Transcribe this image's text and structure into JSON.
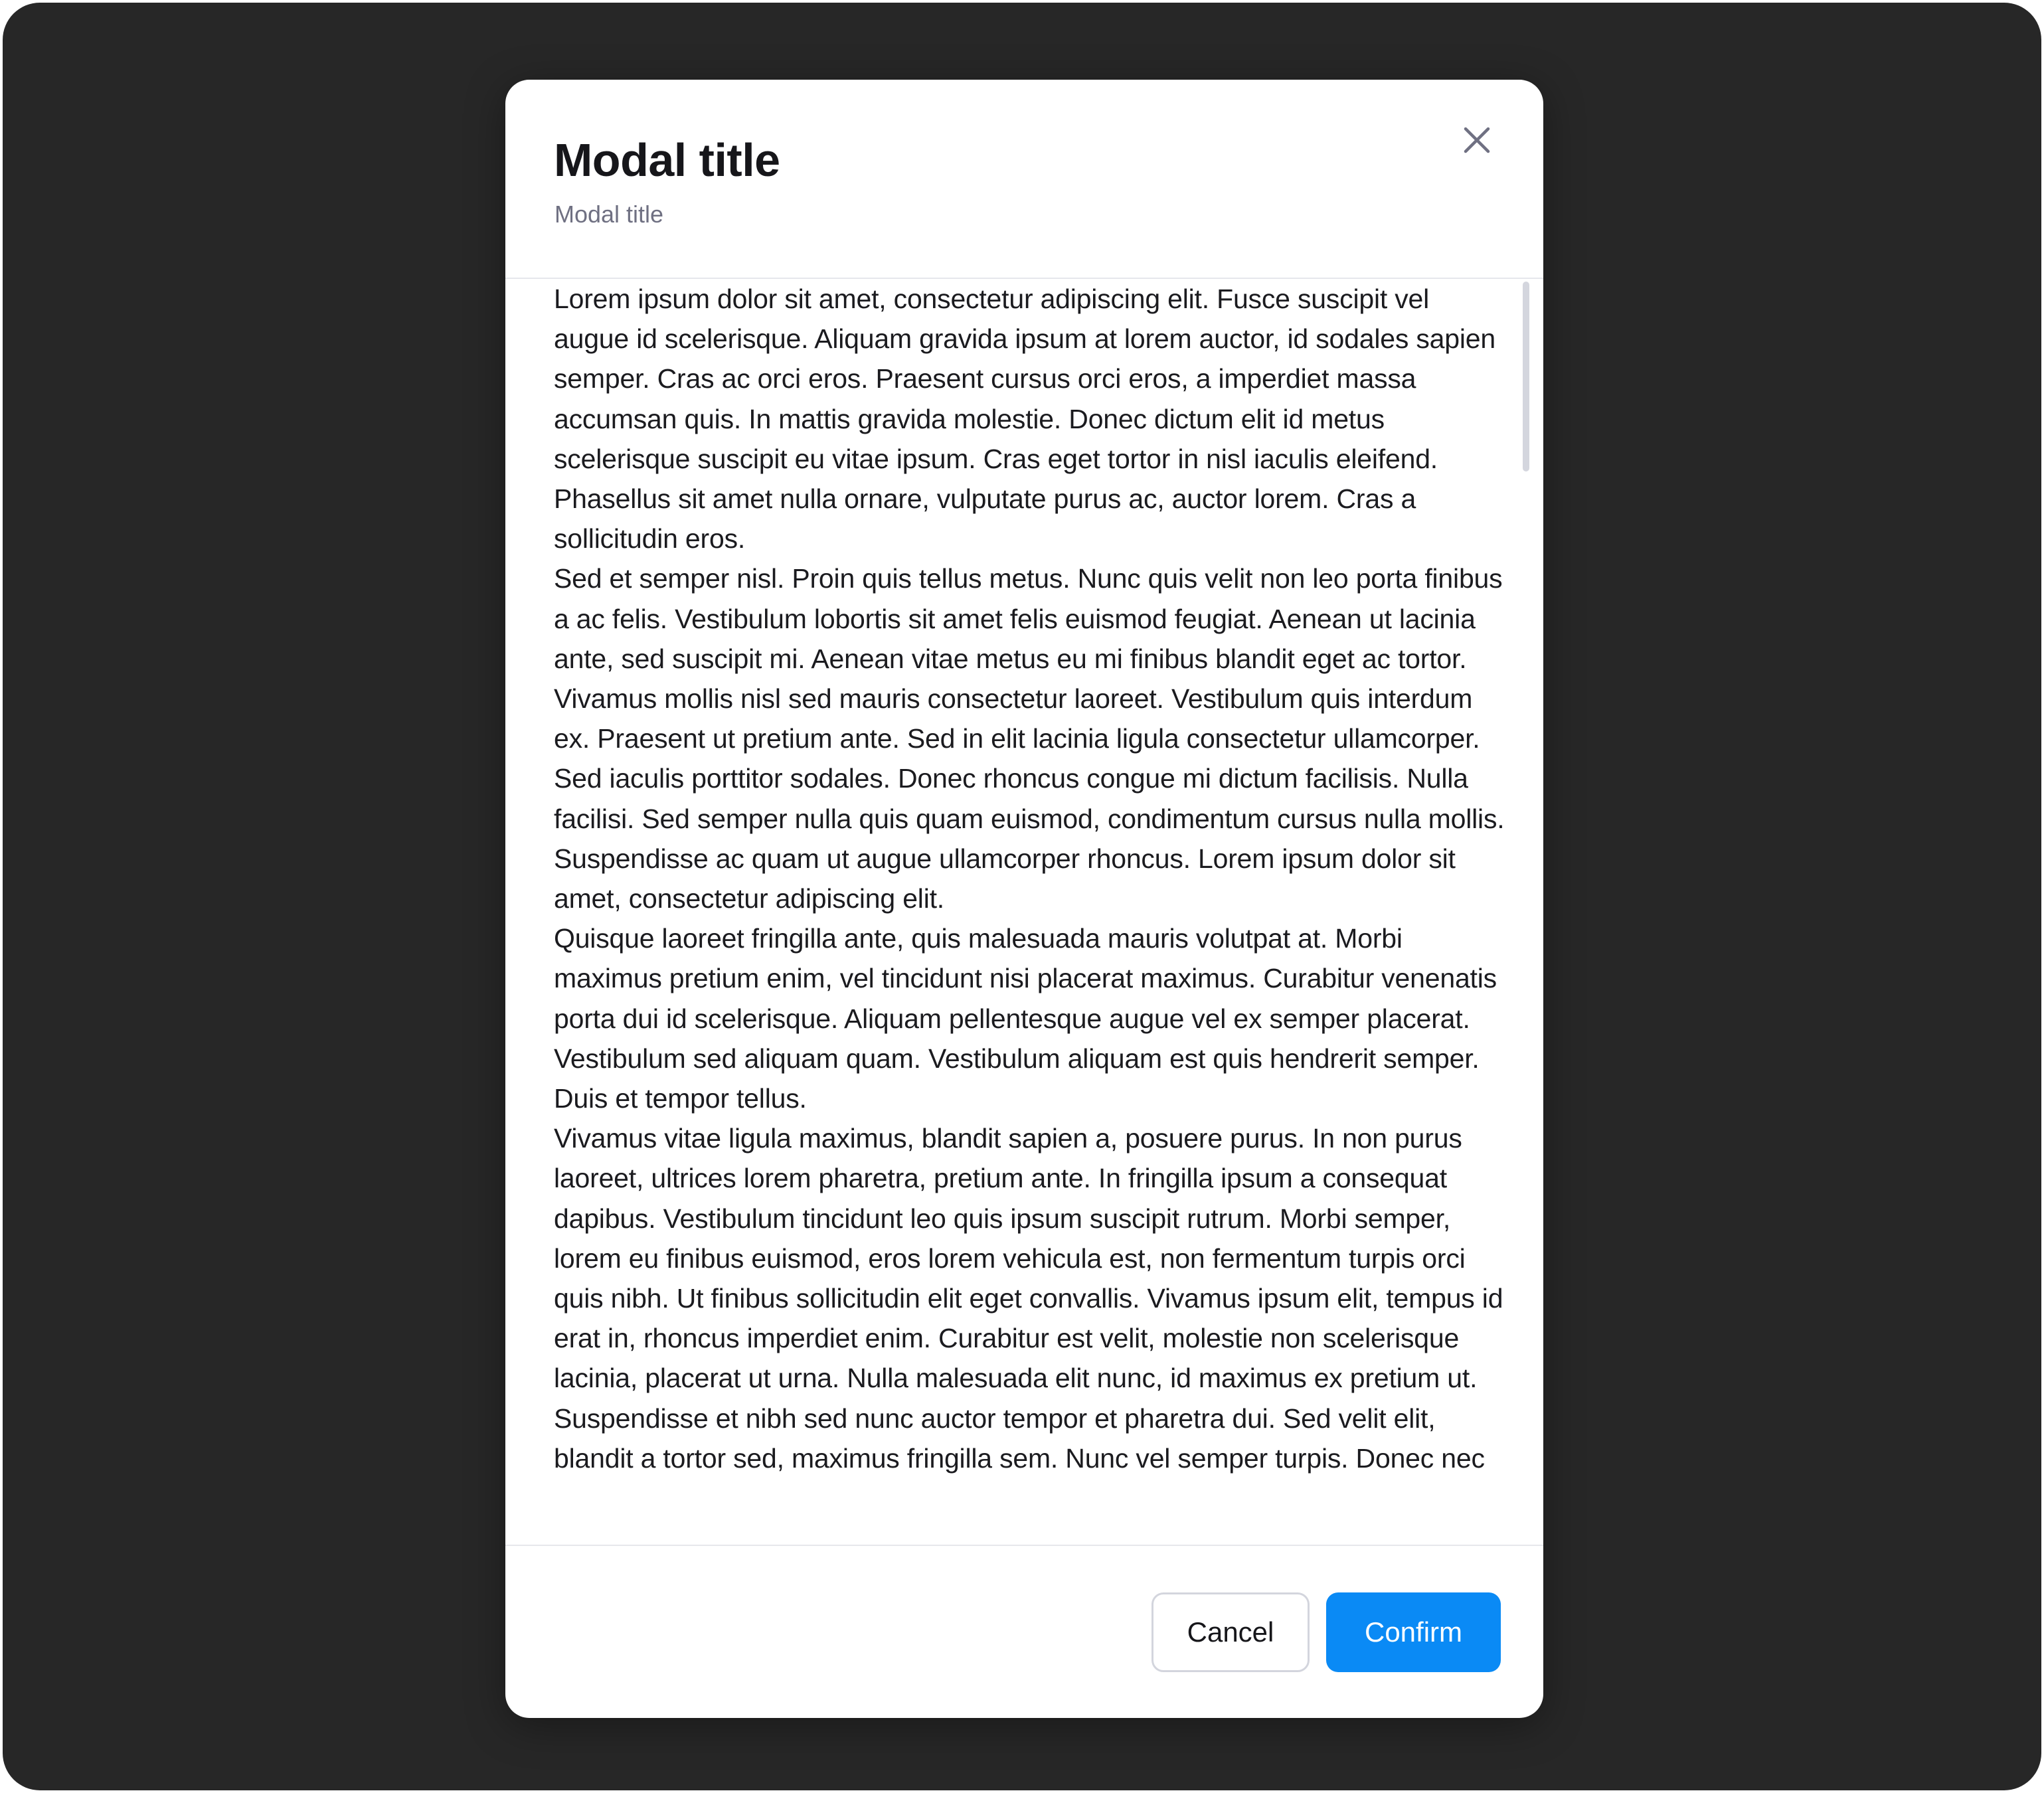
{
  "modal": {
    "title": "Modal title",
    "subtitle": "Modal title",
    "close_icon": "close-icon",
    "body_paragraphs": [
      "Lorem ipsum dolor sit amet, consectetur adipiscing elit. Fusce suscipit vel augue id scelerisque. Aliquam gravida ipsum at lorem auctor, id sodales sapien semper. Cras ac orci eros. Praesent cursus orci eros, a imperdiet massa accumsan quis. In mattis gravida molestie. Donec dictum elit id metus scelerisque suscipit eu vitae ipsum. Cras eget tortor in nisl iaculis eleifend. Phasellus sit amet nulla ornare, vulputate purus ac, auctor lorem. Cras a sollicitudin eros.",
      "Sed et semper nisl. Proin quis tellus metus. Nunc quis velit non leo porta finibus a ac felis. Vestibulum lobortis sit amet felis euismod feugiat. Aenean ut lacinia ante, sed suscipit mi. Aenean vitae metus eu mi finibus blandit eget ac tortor. Vivamus mollis nisl sed mauris consectetur laoreet. Vestibulum quis interdum ex. Praesent ut pretium ante. Sed in elit lacinia ligula consectetur ullamcorper. Sed iaculis porttitor sodales. Donec rhoncus congue mi dictum facilisis. Nulla facilisi. Sed semper nulla quis quam euismod, condimentum cursus nulla mollis. Suspendisse ac quam ut augue ullamcorper rhoncus. Lorem ipsum dolor sit amet, consectetur adipiscing elit.",
      "Quisque laoreet fringilla ante, quis malesuada mauris volutpat at. Morbi maximus pretium enim, vel tincidunt nisi placerat maximus. Curabitur venenatis porta dui id scelerisque. Aliquam pellentesque augue vel ex semper placerat. Vestibulum sed aliquam quam. Vestibulum aliquam est quis hendrerit semper. Duis et tempor tellus.",
      "Vivamus vitae ligula maximus, blandit sapien a, posuere purus. In non purus laoreet, ultrices lorem pharetra, pretium ante. In fringilla ipsum a consequat dapibus. Vestibulum tincidunt leo quis ipsum suscipit rutrum. Morbi semper, lorem eu finibus euismod, eros lorem vehicula est, non fermentum turpis orci quis nibh. Ut finibus sollicitudin elit eget convallis. Vivamus ipsum elit, tempus id erat in, rhoncus imperdiet enim. Curabitur est velit, molestie non scelerisque lacinia, placerat ut urna. Nulla malesuada elit nunc, id maximus ex pretium ut. Suspendisse et nibh sed nunc auctor tempor et pharetra dui. Sed velit elit, blandit a tortor sed, maximus fringilla sem. Nunc vel semper turpis. Donec nec"
    ],
    "footer": {
      "cancel_label": "Cancel",
      "confirm_label": "Confirm"
    }
  },
  "colors": {
    "backdrop": "#272727",
    "modal_background": "#ffffff",
    "title_text": "#16161a",
    "subtitle_text": "#6f7082",
    "body_text": "#1b1b1f",
    "divider": "#e6e7ec",
    "confirm_background": "#0a8af5",
    "confirm_text": "#ffffff",
    "cancel_border": "#d3d5dd"
  }
}
